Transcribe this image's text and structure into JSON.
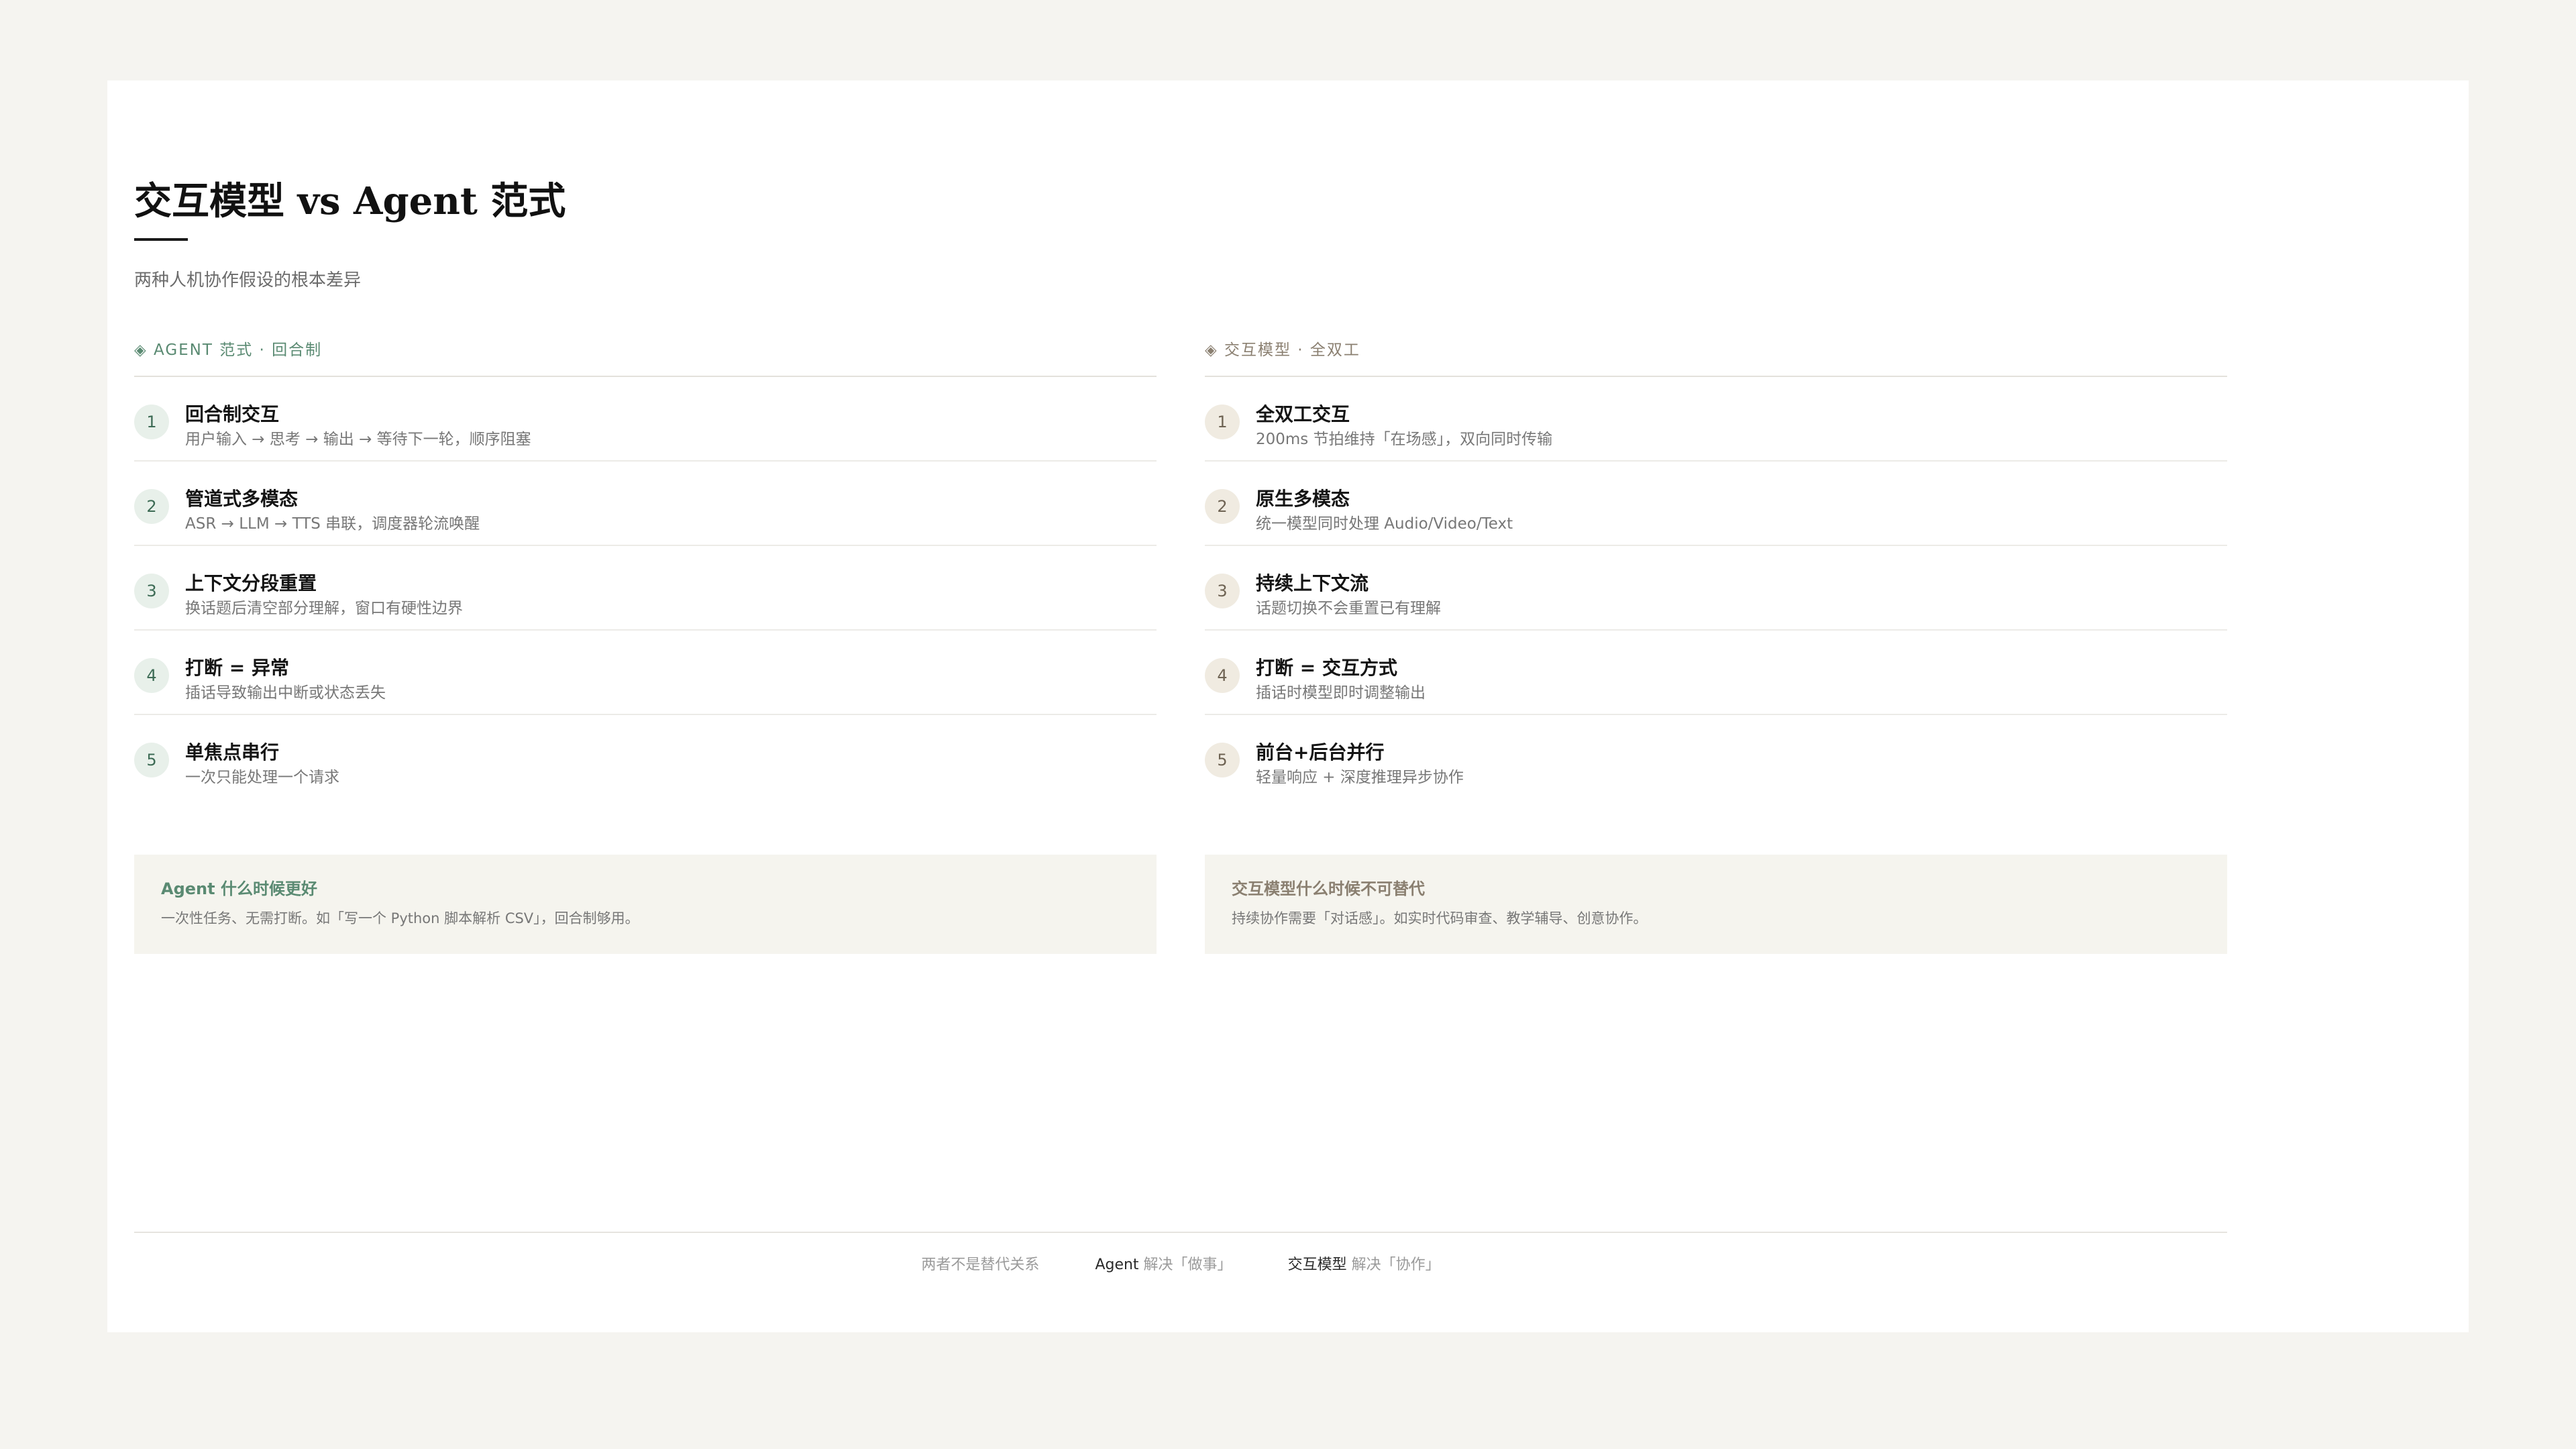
{
  "title": "交互模型 vs Agent 范式",
  "subtitle": "两种人机协作假设的根本差异",
  "columns": {
    "left": {
      "header": "◈ AGENT 范式 · 回合制",
      "items": [
        {
          "num": "1",
          "title": "回合制交互",
          "desc": "用户输入 → 思考 → 输出 → 等待下一轮，顺序阻塞"
        },
        {
          "num": "2",
          "title": "管道式多模态",
          "desc": "ASR → LLM → TTS 串联，调度器轮流唤醒"
        },
        {
          "num": "3",
          "title": "上下文分段重置",
          "desc": "换话题后清空部分理解，窗口有硬性边界"
        },
        {
          "num": "4",
          "title": "打断 = 异常",
          "desc": "插话导致输出中断或状态丢失"
        },
        {
          "num": "5",
          "title": "单焦点串行",
          "desc": "一次只能处理一个请求"
        }
      ]
    },
    "right": {
      "header": "◈ 交互模型 · 全双工",
      "items": [
        {
          "num": "1",
          "title": "全双工交互",
          "desc": "200ms 节拍维持「在场感」，双向同时传输"
        },
        {
          "num": "2",
          "title": "原生多模态",
          "desc": "统一模型同时处理 Audio/Video/Text"
        },
        {
          "num": "3",
          "title": "持续上下文流",
          "desc": "话题切换不会重置已有理解"
        },
        {
          "num": "4",
          "title": "打断 = 交互方式",
          "desc": "插话时模型即时调整输出"
        },
        {
          "num": "5",
          "title": "前台+后台并行",
          "desc": "轻量响应 + 深度推理异步协作"
        }
      ]
    }
  },
  "notes": {
    "left": {
      "title": "Agent 什么时候更好",
      "desc": "一次性任务、无需打断。如「写一个 Python 脚本解析 CSV」，回合制够用。"
    },
    "right": {
      "title": "交互模型什么时候不可替代",
      "desc": "持续协作需要「对话感」。如实时代码审查、教学辅导、创意协作。"
    }
  },
  "footer": {
    "relation": "两者不是替代关系",
    "agent_name": "Agent",
    "agent_role": " 解决「做事」",
    "model_name": "交互模型",
    "model_role": " 解决「协作」"
  }
}
